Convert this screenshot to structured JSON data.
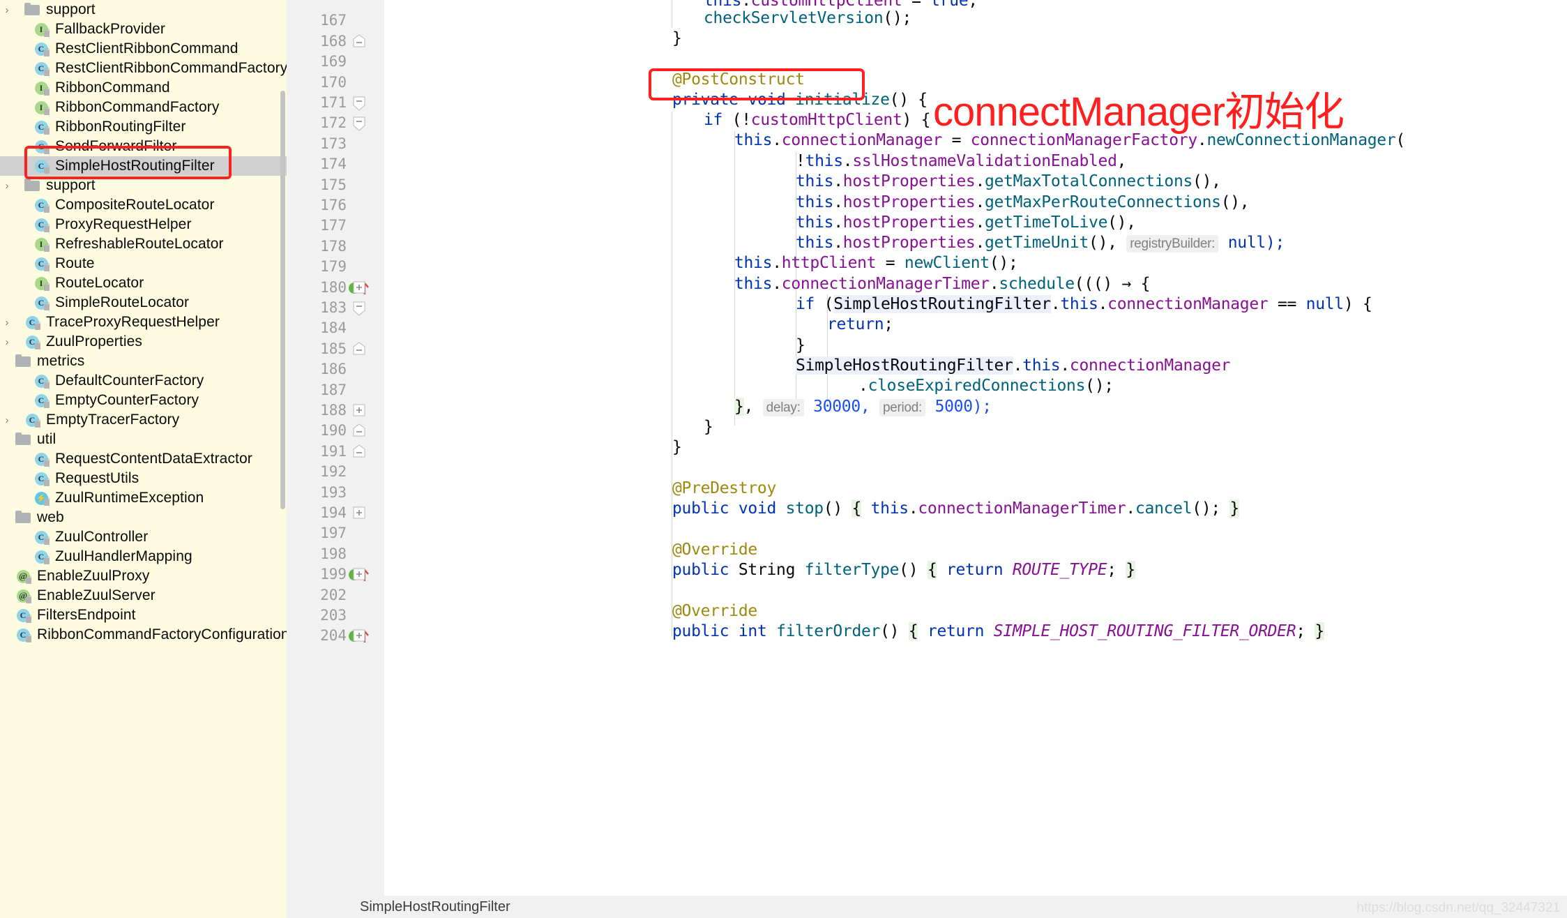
{
  "project_tree": {
    "items": [
      {
        "indent": 1,
        "chevron": "›",
        "icon": "folder",
        "label": "support",
        "selected": false
      },
      {
        "indent": 2,
        "chevron": "",
        "icon": "interface",
        "label": "FallbackProvider",
        "selected": false
      },
      {
        "indent": 2,
        "chevron": "",
        "icon": "class",
        "label": "RestClientRibbonCommand",
        "selected": false
      },
      {
        "indent": 2,
        "chevron": "",
        "icon": "class",
        "label": "RestClientRibbonCommandFactory",
        "selected": false
      },
      {
        "indent": 2,
        "chevron": "",
        "icon": "interface",
        "label": "RibbonCommand",
        "selected": false
      },
      {
        "indent": 2,
        "chevron": "",
        "icon": "interface",
        "label": "RibbonCommandFactory",
        "selected": false
      },
      {
        "indent": 2,
        "chevron": "",
        "icon": "class",
        "label": "RibbonRoutingFilter",
        "selected": false
      },
      {
        "indent": 2,
        "chevron": "",
        "icon": "class",
        "label": "SendForwardFilter",
        "selected": false
      },
      {
        "indent": 2,
        "chevron": "",
        "icon": "class",
        "label": "SimpleHostRoutingFilter",
        "selected": true
      },
      {
        "indent": 1,
        "chevron": "›",
        "icon": "folder",
        "label": "support",
        "selected": false
      },
      {
        "indent": 2,
        "chevron": "",
        "icon": "class",
        "label": "CompositeRouteLocator",
        "selected": false
      },
      {
        "indent": 2,
        "chevron": "",
        "icon": "class",
        "label": "ProxyRequestHelper",
        "selected": false
      },
      {
        "indent": 2,
        "chevron": "",
        "icon": "interface",
        "label": "RefreshableRouteLocator",
        "selected": false
      },
      {
        "indent": 2,
        "chevron": "",
        "icon": "class",
        "label": "Route",
        "selected": false
      },
      {
        "indent": 2,
        "chevron": "",
        "icon": "interface",
        "label": "RouteLocator",
        "selected": false
      },
      {
        "indent": 2,
        "chevron": "",
        "icon": "class",
        "label": "SimpleRouteLocator",
        "selected": false
      },
      {
        "indent": 1,
        "chevron": "›",
        "icon": "class",
        "label": "TraceProxyRequestHelper",
        "selected": false
      },
      {
        "indent": 1,
        "chevron": "›",
        "icon": "class",
        "label": "ZuulProperties",
        "selected": false
      },
      {
        "indent": 0,
        "chevron": "",
        "icon": "folder",
        "label": "metrics",
        "selected": false
      },
      {
        "indent": 2,
        "chevron": "",
        "icon": "class",
        "label": "DefaultCounterFactory",
        "selected": false
      },
      {
        "indent": 2,
        "chevron": "",
        "icon": "class",
        "label": "EmptyCounterFactory",
        "selected": false
      },
      {
        "indent": 1,
        "chevron": "›",
        "icon": "class",
        "label": "EmptyTracerFactory",
        "selected": false
      },
      {
        "indent": 0,
        "chevron": "",
        "icon": "folder",
        "label": "util",
        "selected": false
      },
      {
        "indent": 2,
        "chevron": "",
        "icon": "class",
        "label": "RequestContentDataExtractor",
        "selected": false
      },
      {
        "indent": 2,
        "chevron": "",
        "icon": "class",
        "label": "RequestUtils",
        "selected": false
      },
      {
        "indent": 2,
        "chevron": "",
        "icon": "exception",
        "label": "ZuulRuntimeException",
        "selected": false
      },
      {
        "indent": 0,
        "chevron": "",
        "icon": "folder",
        "label": "web",
        "selected": false
      },
      {
        "indent": 2,
        "chevron": "",
        "icon": "class",
        "label": "ZuulController",
        "selected": false
      },
      {
        "indent": 2,
        "chevron": "",
        "icon": "class",
        "label": "ZuulHandlerMapping",
        "selected": false
      },
      {
        "indent": 0,
        "chevron": "",
        "icon": "annotation",
        "label": "EnableZuulProxy",
        "selected": false
      },
      {
        "indent": 0,
        "chevron": "",
        "icon": "annotation",
        "label": "EnableZuulServer",
        "selected": false
      },
      {
        "indent": 0,
        "chevron": "",
        "icon": "class",
        "label": "FiltersEndpoint",
        "selected": false
      },
      {
        "indent": 0,
        "chevron": "",
        "icon": "class",
        "label": "RibbonCommandFactoryConfiguration",
        "selected": false
      }
    ]
  },
  "editor": {
    "lines": [
      {
        "num": "167",
        "fold": "",
        "marker": "",
        "indent_guides": [
          0
        ]
      },
      {
        "num": "168",
        "fold": "minus-round",
        "marker": "",
        "indent_guides": []
      },
      {
        "num": "169",
        "fold": "",
        "marker": "",
        "indent_guides": []
      },
      {
        "num": "170",
        "fold": "",
        "marker": "",
        "indent_guides": []
      },
      {
        "num": "171",
        "fold": "minus-flag",
        "marker": "",
        "indent_guides": []
      },
      {
        "num": "172",
        "fold": "minus-flag",
        "marker": "",
        "indent_guides": [
          0
        ]
      },
      {
        "num": "173",
        "fold": "",
        "marker": "",
        "indent_guides": [
          0,
          1
        ]
      },
      {
        "num": "174",
        "fold": "",
        "marker": "",
        "indent_guides": [
          0,
          1,
          2
        ]
      },
      {
        "num": "175",
        "fold": "",
        "marker": "",
        "indent_guides": [
          0,
          1,
          2
        ]
      },
      {
        "num": "176",
        "fold": "",
        "marker": "",
        "indent_guides": [
          0,
          1,
          2
        ]
      },
      {
        "num": "177",
        "fold": "",
        "marker": "",
        "indent_guides": [
          0,
          1,
          2
        ]
      },
      {
        "num": "178",
        "fold": "",
        "marker": "",
        "indent_guides": [
          0,
          1,
          2
        ]
      },
      {
        "num": "179",
        "fold": "",
        "marker": "",
        "indent_guides": [
          0,
          1
        ]
      },
      {
        "num": "180",
        "fold": "plus",
        "marker": "implemented-up",
        "indent_guides": [
          0,
          1
        ]
      },
      {
        "num": "183",
        "fold": "minus-flag",
        "marker": "",
        "indent_guides": [
          0,
          1,
          2
        ]
      },
      {
        "num": "184",
        "fold": "",
        "marker": "",
        "indent_guides": [
          0,
          1,
          2,
          3
        ]
      },
      {
        "num": "185",
        "fold": "minus-round",
        "marker": "",
        "indent_guides": [
          0,
          1,
          2
        ]
      },
      {
        "num": "186",
        "fold": "",
        "marker": "",
        "indent_guides": [
          0,
          1,
          2
        ]
      },
      {
        "num": "187",
        "fold": "",
        "marker": "",
        "indent_guides": [
          0,
          1,
          2,
          3
        ]
      },
      {
        "num": "188",
        "fold": "plus",
        "marker": "",
        "indent_guides": [
          0,
          1
        ]
      },
      {
        "num": "190",
        "fold": "minus-round",
        "marker": "",
        "indent_guides": [
          0
        ]
      },
      {
        "num": "191",
        "fold": "minus-round",
        "marker": "",
        "indent_guides": []
      },
      {
        "num": "192",
        "fold": "",
        "marker": "",
        "indent_guides": []
      },
      {
        "num": "193",
        "fold": "",
        "marker": "",
        "indent_guides": []
      },
      {
        "num": "194",
        "fold": "plus",
        "marker": "",
        "indent_guides": []
      },
      {
        "num": "197",
        "fold": "",
        "marker": "",
        "indent_guides": []
      },
      {
        "num": "198",
        "fold": "",
        "marker": "",
        "indent_guides": []
      },
      {
        "num": "199",
        "fold": "plus",
        "marker": "implemented-up",
        "indent_guides": []
      },
      {
        "num": "202",
        "fold": "",
        "marker": "",
        "indent_guides": []
      },
      {
        "num": "203",
        "fold": "",
        "marker": "",
        "indent_guides": []
      },
      {
        "num": "204",
        "fold": "plus",
        "marker": "implemented-up",
        "indent_guides": []
      }
    ],
    "code_text": {
      "l166": "this.customHttpClient = true;",
      "l167": "checkServletVersion();",
      "l168": "}",
      "l170": "@PostConstruct",
      "l171": "private void initialize() {",
      "l172": "if (!customHttpClient) {",
      "l173": "this.connectionManager = connectionManagerFactory.newConnectionManager(",
      "l174": "!this.sslHostnameValidationEnabled,",
      "l175": "this.hostProperties.getMaxTotalConnections(),",
      "l176": "this.hostProperties.getMaxPerRouteConnections(),",
      "l177": "this.hostProperties.getTimeToLive(),",
      "l178": "this.hostProperties.getTimeUnit(),",
      "l178_hint": "registryBuilder:",
      "l178_null": "null);",
      "l179": "this.httpClient = newClient();",
      "l180": "this.connectionManagerTimer.schedule((() → {",
      "l183": "if (SimpleHostRoutingFilter.this.connectionManager == null) {",
      "l184": "return;",
      "l185": "}",
      "l186": "SimpleHostRoutingFilter.this.connectionManager",
      "l187": ".closeExpiredConnections();",
      "l188_brace": "},",
      "l188_delay_hint": "delay:",
      "l188_delay": "30000,",
      "l188_period_hint": "period:",
      "l188_period": "5000);",
      "l190": "}",
      "l191": "}",
      "l193": "@PreDestroy",
      "l194": "public void stop() { this.connectionManagerTimer.cancel(); }",
      "l198": "@Override",
      "l199": "public String filterType() { return ROUTE_TYPE; }",
      "l203": "@Override",
      "l204": "public int filterOrder() { return SIMPLE_HOST_ROUTING_FILTER_ORDER; }"
    }
  },
  "annotation": {
    "text": "connectManager初始化",
    "color": "#ff1f1f"
  },
  "statusbar": {
    "breadcrumb": "SimpleHostRoutingFilter",
    "watermark": "https://blog.csdn.net/qq_32447321"
  }
}
